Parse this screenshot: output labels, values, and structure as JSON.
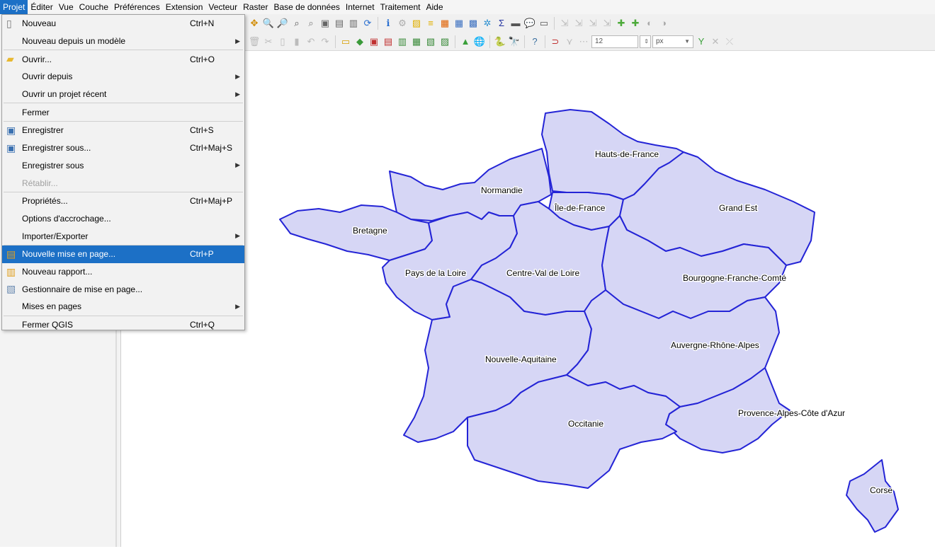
{
  "menubar": [
    "Projet",
    "Éditer",
    "Vue",
    "Couche",
    "Préférences",
    "Extension",
    "Vecteur",
    "Raster",
    "Base de données",
    "Internet",
    "Traitement",
    "Aide"
  ],
  "project_menu": [
    {
      "label": "Nouveau",
      "shortcut": "Ctrl+N",
      "icon": "new-file-icon"
    },
    {
      "label": "Nouveau depuis un modèle",
      "submenu": true
    },
    {
      "sep": true
    },
    {
      "label": "Ouvrir...",
      "shortcut": "Ctrl+O",
      "icon": "folder-icon"
    },
    {
      "label": "Ouvrir depuis",
      "submenu": true
    },
    {
      "label": "Ouvrir un projet récent",
      "submenu": true
    },
    {
      "sep": true
    },
    {
      "label": "Fermer"
    },
    {
      "sep": true
    },
    {
      "label": "Enregistrer",
      "shortcut": "Ctrl+S",
      "icon": "save-icon"
    },
    {
      "label": "Enregistrer sous...",
      "shortcut": "Ctrl+Maj+S",
      "icon": "save-as-icon"
    },
    {
      "label": "Enregistrer sous",
      "submenu": true
    },
    {
      "label": "Rétablir...",
      "disabled": true
    },
    {
      "sep": true
    },
    {
      "label": "Propriétés...",
      "shortcut": "Ctrl+Maj+P"
    },
    {
      "label": "Options d'accrochage..."
    },
    {
      "label": "Importer/Exporter",
      "submenu": true
    },
    {
      "sep": true
    },
    {
      "label": "Nouvelle mise en page...",
      "shortcut": "Ctrl+P",
      "icon": "new-layout-icon",
      "highlighted": true
    },
    {
      "label": "Nouveau rapport...",
      "icon": "new-report-icon"
    },
    {
      "label": "Gestionnaire de mise en page...",
      "icon": "layout-manager-icon"
    },
    {
      "label": "Mises en pages",
      "submenu": true
    },
    {
      "sep": true
    },
    {
      "label": "Fermer QGIS",
      "shortcut": "Ctrl+Q"
    }
  ],
  "toolbar": {
    "font_size_value": "12",
    "unit_value": "px"
  },
  "map_labels": {
    "hauts_de_france": "Hauts-de-France",
    "normandie": "Normandie",
    "ile_de_france": "Île-de-France",
    "grand_est": "Grand Est",
    "bretagne": "Bretagne",
    "pays_de_la_loire": "Pays de la Loire",
    "centre_val_de_loire": "Centre-Val de Loire",
    "bourgogne_franche_comte": "Bourgogne-Franche-Comté",
    "nouvelle_aquitaine": "Nouvelle-Aquitaine",
    "auvergne_rhone_alpes": "Auvergne-Rhône-Alpes",
    "occitanie": "Occitanie",
    "provence": "Provence-Alpes-Côte d'Azur",
    "corse": "Corse"
  },
  "colors": {
    "region_fill": "#d6d6f5",
    "region_stroke": "#2424d6",
    "menu_highlight": "#1c70c6"
  }
}
